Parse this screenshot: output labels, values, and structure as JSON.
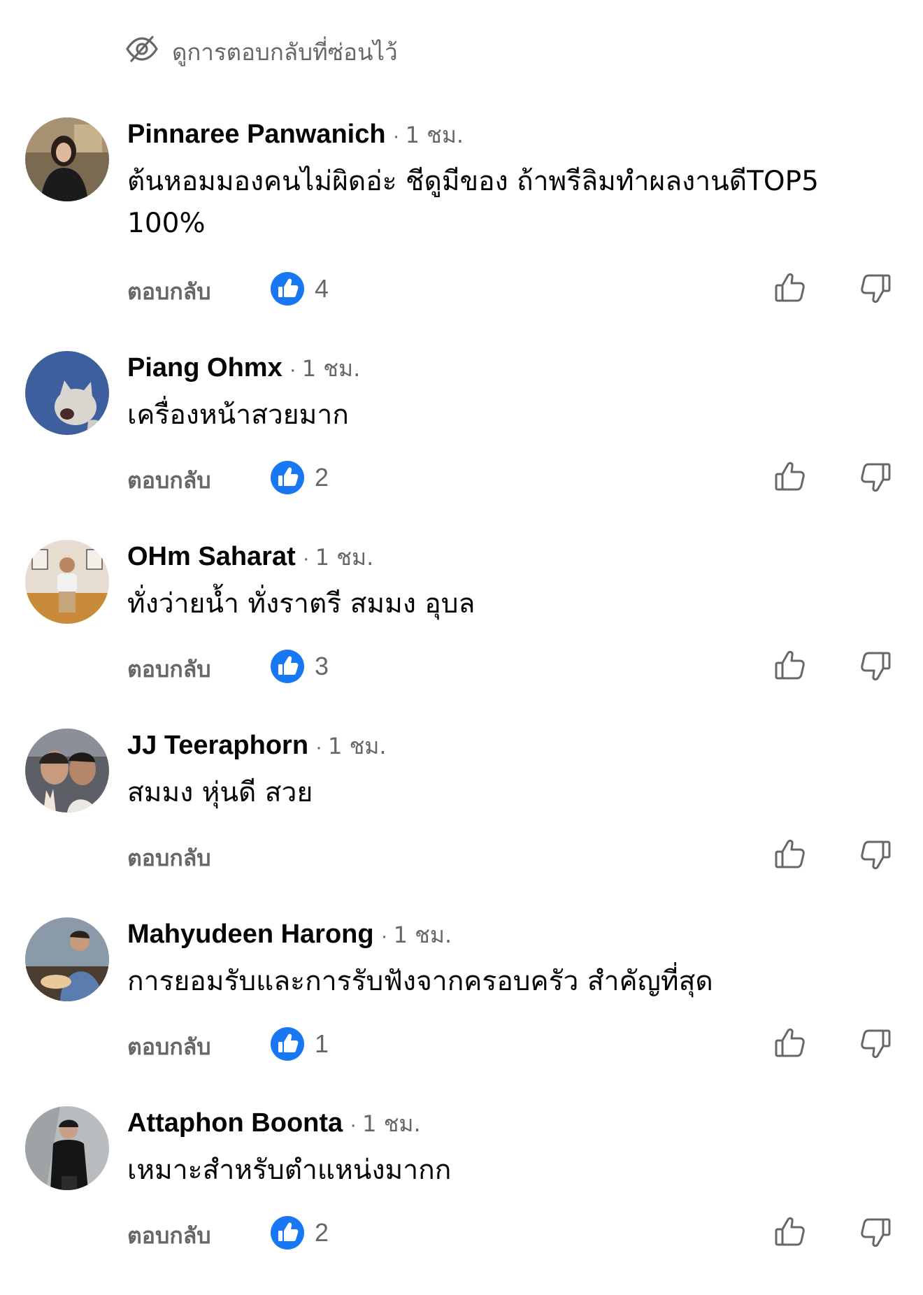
{
  "hidden_replies": {
    "label": "ดูการตอบกลับที่ซ่อนไว้",
    "icon": "eye-slash-icon"
  },
  "reply_label": "ตอบกลับ",
  "colors": {
    "like_blue": "#1877f2",
    "secondary_text": "#65676b",
    "primary_text": "#050505"
  },
  "comments": [
    {
      "author": "Pinnaree Panwanich",
      "time": "1 ชม.",
      "text": "ต้นหอมมองคนไม่ผิดอ่ะ ชีดูมีของ ถ้าพรีลิมทำผลงานดีTOP5 100%",
      "likes": "4"
    },
    {
      "author": "Piang Ohmx",
      "time": "1 ชม.",
      "text": "เครื่องหน้าสวยมาก",
      "likes": "2"
    },
    {
      "author": "OHm Saharat",
      "time": "1 ชม.",
      "text": "ทั่งว่ายน้ำ  ทั่งราตรี สมมง อุบล",
      "likes": "3"
    },
    {
      "author": "JJ Teeraphorn",
      "time": "1 ชม.",
      "text": "สมมง หุ่นดี สวย",
      "likes": ""
    },
    {
      "author": "Mahyudeen Harong",
      "time": "1 ชม.",
      "text": "การยอมรับและการรับฟังจากครอบครัว สำคัญที่สุด",
      "likes": "1"
    },
    {
      "author": "Attaphon Boonta",
      "time": "1 ชม.",
      "text": "เหมาะสำหรับตำแหน่งมากก",
      "likes": "2"
    }
  ]
}
